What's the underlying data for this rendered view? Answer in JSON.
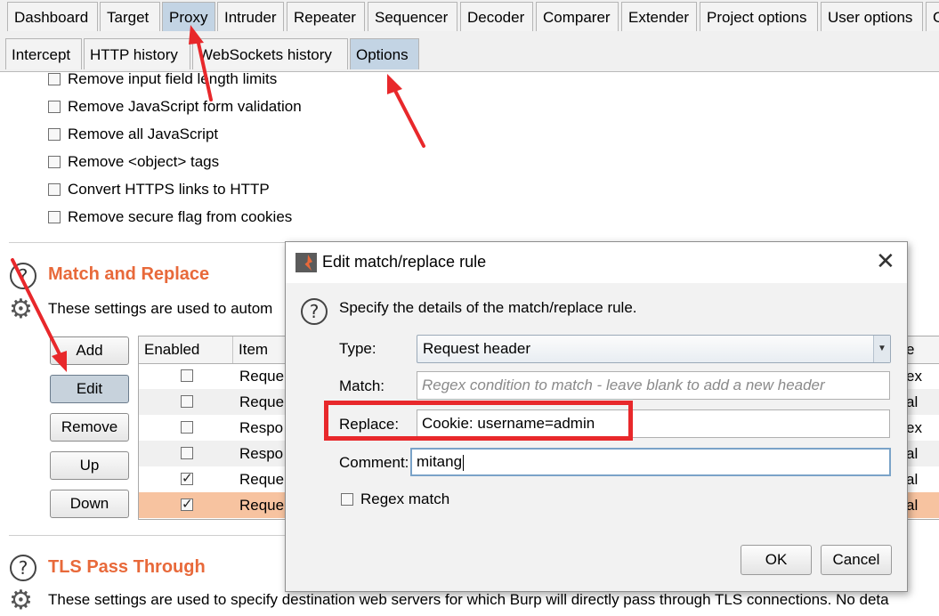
{
  "top_tabs": [
    {
      "label": "Dashboard"
    },
    {
      "label": "Target"
    },
    {
      "label": "Proxy"
    },
    {
      "label": "Intruder"
    },
    {
      "label": "Repeater"
    },
    {
      "label": "Sequencer"
    },
    {
      "label": "Decoder"
    },
    {
      "label": "Comparer"
    },
    {
      "label": "Extender"
    },
    {
      "label": "Project options"
    },
    {
      "label": "User options"
    },
    {
      "label": "C"
    }
  ],
  "sub_tabs": [
    {
      "label": "Intercept"
    },
    {
      "label": "HTTP history"
    },
    {
      "label": "WebSockets history"
    },
    {
      "label": "Options"
    }
  ],
  "options": [
    {
      "label": "Remove input field length limits",
      "checked": false
    },
    {
      "label": "Remove JavaScript form validation",
      "checked": false
    },
    {
      "label": "Remove all JavaScript",
      "checked": false
    },
    {
      "label": "Remove <object> tags",
      "checked": false
    },
    {
      "label": "Convert HTTPS links to HTTP",
      "checked": false
    },
    {
      "label": "Remove secure flag from cookies",
      "checked": false
    }
  ],
  "match_replace": {
    "title": "Match and Replace",
    "description": "These settings are used to autom",
    "buttons": {
      "add": "Add",
      "edit": "Edit",
      "remove": "Remove",
      "up": "Up",
      "down": "Down"
    },
    "columns": {
      "enabled": "Enabled",
      "item": "Item",
      "last": "e"
    },
    "rows": [
      {
        "enabled": false,
        "item": "Reque",
        "tail": "ex"
      },
      {
        "enabled": false,
        "item": "Reque",
        "tail": "al"
      },
      {
        "enabled": false,
        "item": "Respo",
        "tail": "ex"
      },
      {
        "enabled": false,
        "item": "Respo",
        "tail": "al"
      },
      {
        "enabled": true,
        "item": "Reque",
        "tail": "al"
      },
      {
        "enabled": true,
        "item": "Reque",
        "tail": "al"
      }
    ]
  },
  "tls": {
    "title": "TLS Pass Through",
    "description": "These settings are used to specify destination web servers for which Burp will directly pass through TLS connections. No deta"
  },
  "dialog": {
    "title": "Edit match/replace rule",
    "close_glyph": "✕",
    "instruction": "Specify the details of the match/replace rule.",
    "type_label": "Type:",
    "type_value": "Request header",
    "match_label": "Match:",
    "match_placeholder": "Regex condition to match - leave blank to add a new header",
    "replace_label": "Replace:",
    "replace_value": "Cookie: username=admin",
    "comment_label": "Comment:",
    "comment_value": "mitang",
    "regex_label": "Regex match",
    "regex_checked": false,
    "ok_label": "OK",
    "cancel_label": "Cancel"
  },
  "colors": {
    "section_title": "#e8693a",
    "annotation_red": "#e8282b",
    "selected_row": "#f7c3a0",
    "active_tab": "#c3d4e4"
  }
}
